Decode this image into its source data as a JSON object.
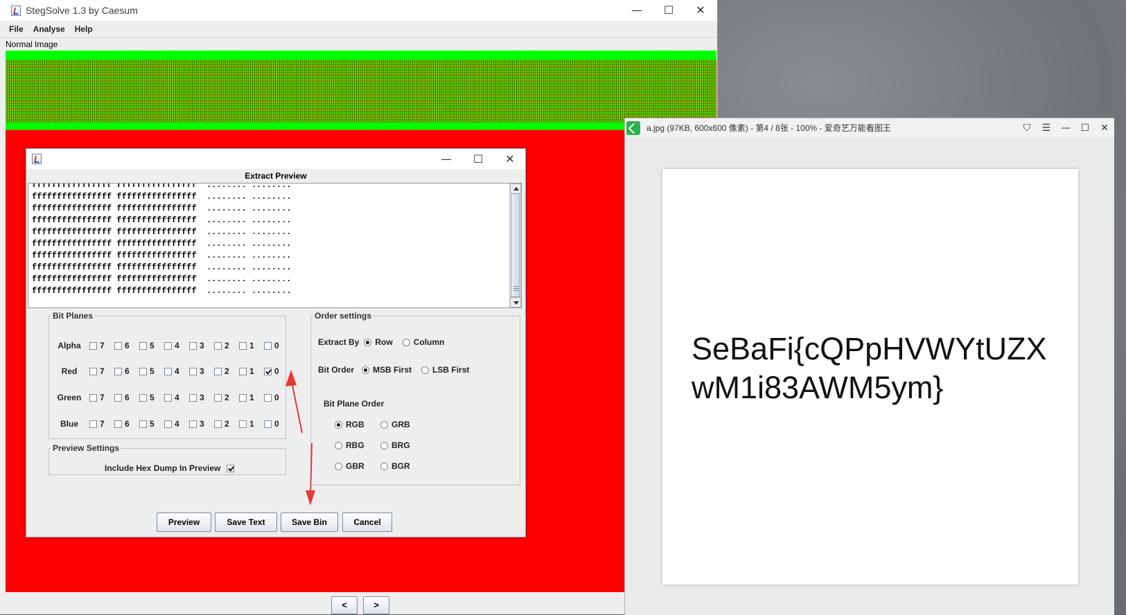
{
  "stegsolve": {
    "title": "StegSolve 1.3 by Caesum",
    "window_controls": [
      "—",
      "☐",
      "✕"
    ],
    "menu": [
      "File",
      "Analyse",
      "Help"
    ],
    "image_label": "Normal Image",
    "nav": [
      "<",
      ">"
    ]
  },
  "dialog": {
    "heading": "Extract Preview",
    "window_controls": [
      "—",
      "☐",
      "✕"
    ],
    "preview_lines": [
      "ffffffffffffffff ffffffffffffffff  ........ ........",
      "ffffffffffffffff ffffffffffffffff  ........ ........",
      "ffffffffffffffff ffffffffffffffff  ........ ........",
      "ffffffffffffffff ffffffffffffffff  ........ ........",
      "ffffffffffffffff ffffffffffffffff  ........ ........",
      "ffffffffffffffff ffffffffffffffff  ........ ........",
      "ffffffffffffffff ffffffffffffffff  ........ ........",
      "ffffffffffffffff ffffffffffffffff  ........ ........",
      "ffffffffffffffff ffffffffffffffff  ........ ........",
      "ffffffffffffffff ffffffffffffffff  ........ ........"
    ],
    "bit_planes": {
      "legend": "Bit Planes",
      "bits": [
        "7",
        "6",
        "5",
        "4",
        "3",
        "2",
        "1",
        "0"
      ],
      "rows": [
        {
          "name": "Alpha",
          "checked": []
        },
        {
          "name": "Red",
          "checked": [
            "0"
          ]
        },
        {
          "name": "Green",
          "checked": []
        },
        {
          "name": "Blue",
          "checked": []
        }
      ]
    },
    "preview_settings": {
      "legend": "Preview Settings",
      "hex_dump_label": "Include Hex Dump In Preview",
      "hex_dump_checked": true
    },
    "order_settings": {
      "legend": "Order settings",
      "extract_by_label": "Extract By",
      "extract_by_options": [
        "Row",
        "Column"
      ],
      "extract_by_selected": "Row",
      "bit_order_label": "Bit Order",
      "bit_order_options": [
        "MSB First",
        "LSB First"
      ],
      "bit_order_selected": "MSB First",
      "bit_plane_order_label": "Bit Plane Order",
      "bit_plane_order_options": [
        "RGB",
        "GRB",
        "RBG",
        "BRG",
        "GBR",
        "BGR"
      ],
      "bit_plane_order_selected": "RGB"
    },
    "buttons": [
      "Preview",
      "Save Text",
      "Save Bin",
      "Cancel"
    ]
  },
  "viewer": {
    "title": "a.jpg (97KB, 600x600 像素) - 第4 / 8张 - 100% - 爱奇艺万能看图王",
    "flag_text": "SeBaFi{cQPpHVWYtUZXwM1i83AWM5ym}"
  },
  "colors": {
    "image_red": "#ff0000",
    "image_green": "#00ff00",
    "annotation_arrow": "#e53935"
  }
}
